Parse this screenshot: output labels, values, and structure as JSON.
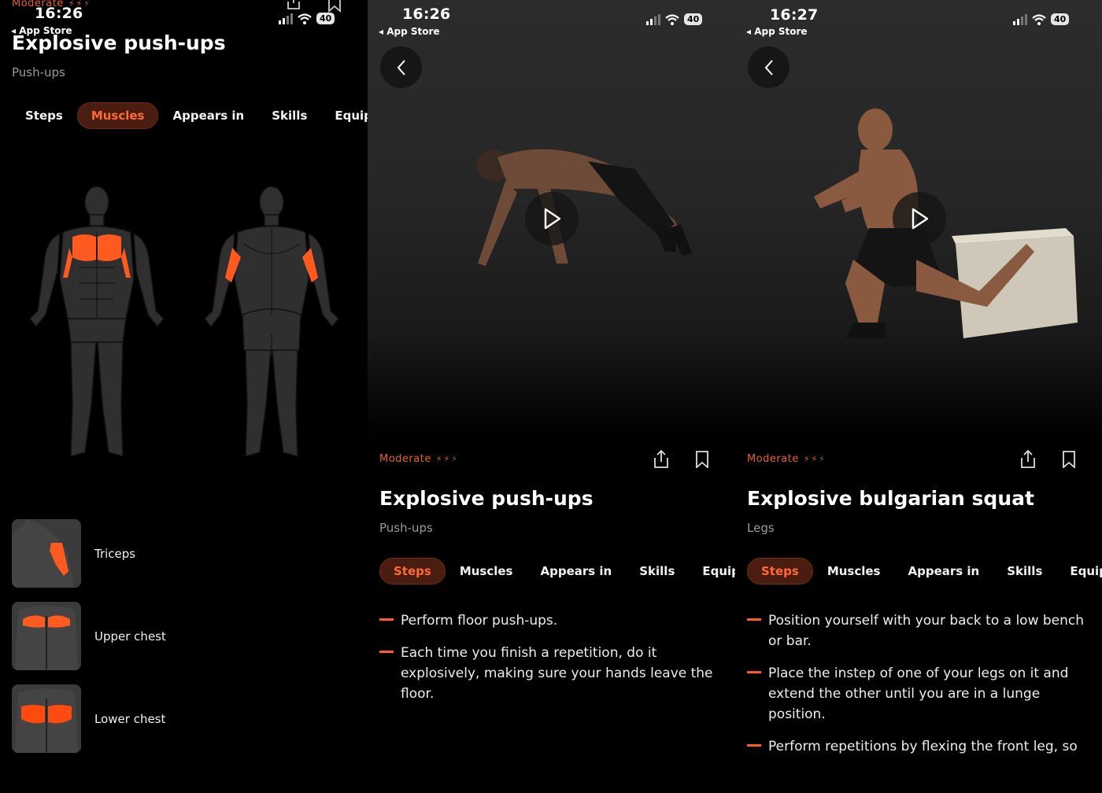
{
  "screens": [
    {
      "status": {
        "time": "16:26",
        "back_app": "◂ App Store",
        "battery": "40"
      },
      "difficulty": "Moderate",
      "title": "Explosive push-ups",
      "subtitle": "Push-ups",
      "tabs": [
        "Steps",
        "Muscles",
        "Appears in",
        "Skills",
        "Equipme"
      ],
      "active_tab": "Muscles",
      "muscles": [
        {
          "label": "Triceps"
        },
        {
          "label": "Upper chest"
        },
        {
          "label": "Lower chest"
        }
      ]
    },
    {
      "status": {
        "time": "16:26",
        "back_app": "◂ App Store",
        "battery": "40"
      },
      "difficulty": "Moderate",
      "title": "Explosive push-ups",
      "subtitle": "Push-ups",
      "tabs": [
        "Steps",
        "Muscles",
        "Appears in",
        "Skills",
        "Equipme"
      ],
      "active_tab": "Steps",
      "steps": [
        "Perform floor push-ups.",
        "Each time you finish a repetition, do it explosively, making sure your hands leave the floor."
      ]
    },
    {
      "status": {
        "time": "16:27",
        "back_app": "◂ App Store",
        "battery": "40"
      },
      "difficulty": "Moderate",
      "title": "Explosive bulgarian squat",
      "subtitle": "Legs",
      "tabs": [
        "Steps",
        "Muscles",
        "Appears in",
        "Skills",
        "Equipme"
      ],
      "active_tab": "Steps",
      "steps": [
        "Position yourself with your back to a low bench or bar.",
        "Place the instep of one of your legs on it and extend the other until you are in a lunge position.",
        "Perform repetitions by flexing the front leg, so"
      ]
    }
  ],
  "colors": {
    "accent": "#ff6a35",
    "active_tab_bg": "#4a1d10",
    "muscle_highlight": "#ff5a1f",
    "background": "#000000"
  },
  "difficulty_level": {
    "value": 2,
    "max": 3
  },
  "icons": [
    "chevron-left-icon",
    "play-icon",
    "share-icon",
    "bookmark-icon",
    "signal-icon",
    "wifi-icon",
    "battery-icon"
  ]
}
